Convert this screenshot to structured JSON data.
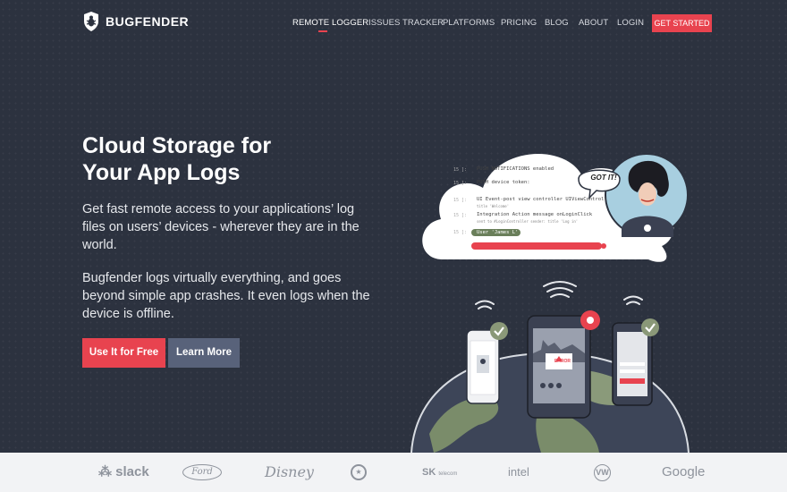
{
  "brand": {
    "name": "BUGFENDER",
    "icon": "bug-shield-icon"
  },
  "nav": {
    "items": [
      {
        "label": "REMOTE LOGGER",
        "active": true
      },
      {
        "label": "ISSUES TRACKER"
      },
      {
        "label": "PLATFORMS"
      },
      {
        "label": "PRICING"
      },
      {
        "label": "BLOG"
      },
      {
        "label": "ABOUT"
      },
      {
        "label": "LOGIN"
      }
    ],
    "cta": "GET STARTED"
  },
  "hero": {
    "title_line1": "Cloud Storage for",
    "title_line2": "Your App Logs",
    "paragraph1": "Get fast remote access to your applications’ log files on users’ devices - wherever they are in the world.",
    "paragraph2": "Bugfender logs virtually everything, and goes beyond simple app crashes. It even logs when the device is offline.",
    "primary_button": "Use It for Free",
    "secondary_button": "Learn More"
  },
  "illustration": {
    "speech_bubble": "GOT IT!",
    "log_lines": [
      {
        "num": "15 ]:",
        "text": "PUSH NOTIFICATIONS enabled"
      },
      {
        "num": "15 ]:",
        "text": "PUSH device token:"
      },
      {
        "num": "15 ]:",
        "text": "UI Event-post view controller  UIViewControll",
        "sub": "title 'Welcome'"
      },
      {
        "num": "15 ]:",
        "text": "Integration Action message onLoginClick",
        "sub": "sent to #LoginController  sender: title 'Log in'"
      },
      {
        "num": "15 ]:",
        "text": "User 'James L'"
      }
    ],
    "error_label": "ERROR"
  },
  "logos": [
    "slack",
    "Ford",
    "Disney",
    "Starbucks",
    "SK",
    "intel",
    "VW",
    "Google"
  ],
  "colors": {
    "accent": "#e8434f",
    "background": "#2c323f",
    "secondary_button": "#58627a"
  }
}
